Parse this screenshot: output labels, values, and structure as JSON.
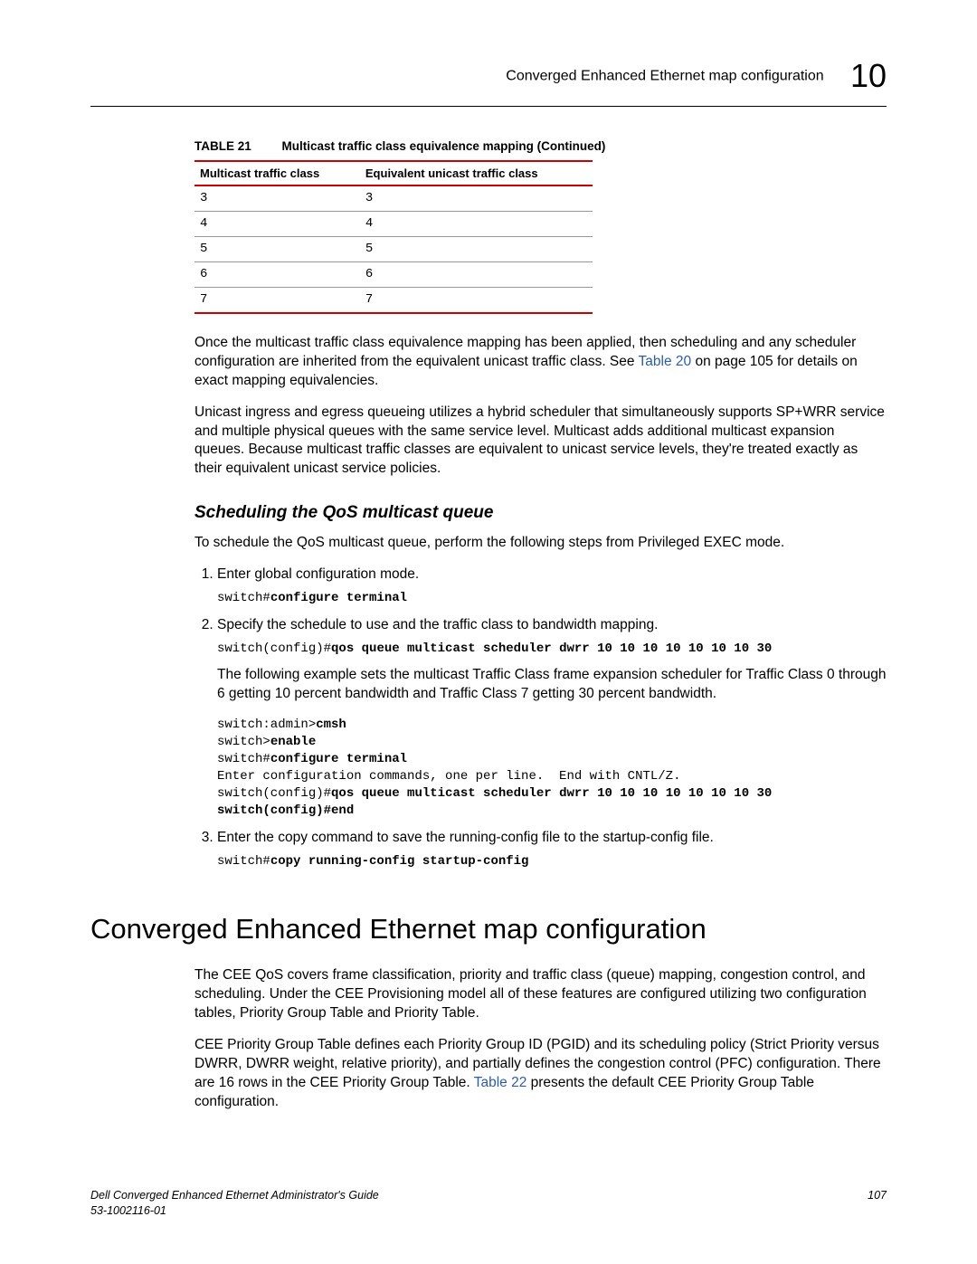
{
  "header": {
    "title": "Converged Enhanced Ethernet map configuration",
    "chapter": "10"
  },
  "table": {
    "label": "TABLE 21",
    "title": "Multicast traffic class equivalence mapping  (Continued)",
    "headers": [
      "Multicast traffic class",
      "Equivalent unicast traffic class"
    ],
    "rows": [
      [
        "3",
        "3"
      ],
      [
        "4",
        "4"
      ],
      [
        "5",
        "5"
      ],
      [
        "6",
        "6"
      ],
      [
        "7",
        "7"
      ]
    ]
  },
  "para1_a": "Once the multicast traffic class equivalence mapping has been applied, then scheduling and any scheduler configuration are inherited from the equivalent unicast traffic class. See ",
  "para1_link": "Table 20",
  "para1_b": " on page 105 for details on exact mapping equivalencies.",
  "para2": "Unicast ingress and egress queueing utilizes a hybrid scheduler that simultaneously supports SP+WRR service and multiple physical queues with the same service level. Multicast adds additional multicast expansion queues. Because multicast traffic classes are equivalent to unicast service levels, they're treated exactly as their equivalent unicast service policies.",
  "subhead": "Scheduling the QoS multicast queue",
  "para3": "To schedule the QoS multicast queue, perform the following steps from Privileged EXEC mode.",
  "step1": {
    "text": "Enter global configuration mode.",
    "code_plain": "switch#",
    "code_bold": "configure terminal"
  },
  "step2": {
    "text": "Specify the schedule to use and the traffic class to bandwidth mapping.",
    "code1_plain": "switch(config)#",
    "code1_bold": "qos queue multicast scheduler dwrr 10 10 10 10 10 10 10 30",
    "para": "The following example sets the multicast Traffic Class frame expansion scheduler for Traffic Class 0 through 6 getting 10 percent bandwidth and Traffic Class 7 getting 30 percent bandwidth.",
    "block_l1a": "switch:admin>",
    "block_l1b": "cmsh",
    "block_l2a": "switch>",
    "block_l2b": "enable",
    "block_l3a": "switch#",
    "block_l3b": "configure terminal",
    "block_l4": "Enter configuration commands, one per line.  End with CNTL/Z.",
    "block_l5a": "switch(config)#",
    "block_l5b": "qos queue multicast scheduler dwrr 10 10 10 10 10 10 10 30",
    "block_l6": "switch(config)#end"
  },
  "step3": {
    "text": "Enter the copy command to save the running-config file to the startup-config file.",
    "code_plain": "switch#",
    "code_bold": "copy running-config startup-config"
  },
  "mainhead": "Converged Enhanced Ethernet map configuration",
  "mpara1": "The CEE QoS covers frame classification, priority and traffic class (queue) mapping, congestion control, and scheduling. Under the CEE Provisioning model all of these features are configured utilizing two configuration tables, Priority Group Table and Priority Table.",
  "mpara2_a": "CEE Priority Group Table defines each Priority Group ID (PGID) and its scheduling policy (Strict Priority versus DWRR, DWRR weight, relative priority), and partially defines the congestion control (PFC) configuration. There are 16 rows in the CEE Priority Group Table. ",
  "mpara2_link": "Table 22",
  "mpara2_b": " presents the default CEE Priority Group Table configuration.",
  "footer": {
    "doc": "Dell Converged Enhanced Ethernet Administrator's Guide",
    "docnum": "53-1002116-01",
    "page": "107"
  }
}
